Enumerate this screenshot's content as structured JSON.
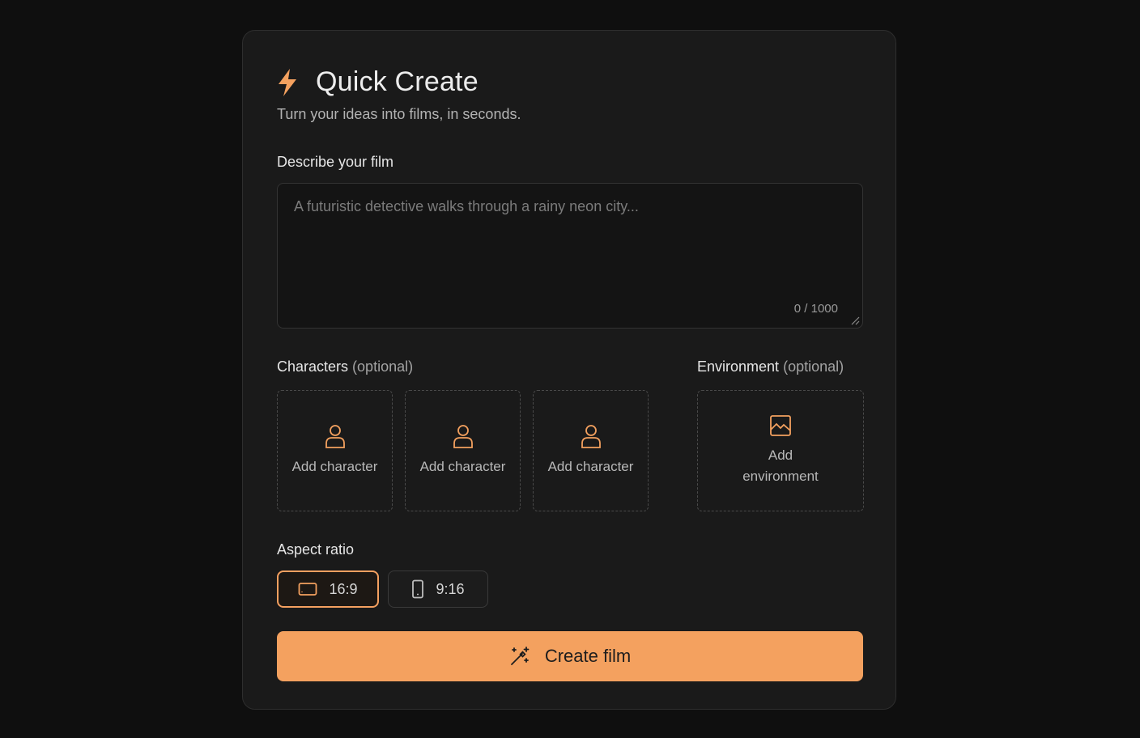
{
  "header": {
    "title": "Quick Create",
    "subtitle": "Turn your ideas into films, in seconds."
  },
  "prompt": {
    "label": "Describe your film",
    "placeholder": "A futuristic detective walks through a rainy neon city...",
    "value": "",
    "char_count": "0 / 1000"
  },
  "characters": {
    "label": "Characters",
    "optional": "(optional)",
    "slots": [
      {
        "label": "Add character",
        "icon": "user-icon"
      },
      {
        "label": "Add character",
        "icon": "user-icon"
      },
      {
        "label": "Add character",
        "icon": "user-icon"
      }
    ]
  },
  "environment": {
    "label": "Environment",
    "optional": "(optional)",
    "slot": {
      "label": "Add environment",
      "icon": "image-icon"
    }
  },
  "aspect_ratio": {
    "label": "Aspect ratio",
    "options": [
      {
        "label": "16:9",
        "icon": "landscape-icon",
        "selected": true
      },
      {
        "label": "9:16",
        "icon": "portrait-phone-icon",
        "selected": false
      }
    ]
  },
  "create_button": {
    "label": "Create film",
    "icon": "magic-wand-icon"
  },
  "colors": {
    "accent": "#f4a15f",
    "background": "#0f0f0f",
    "card": "#1a1a1a"
  }
}
